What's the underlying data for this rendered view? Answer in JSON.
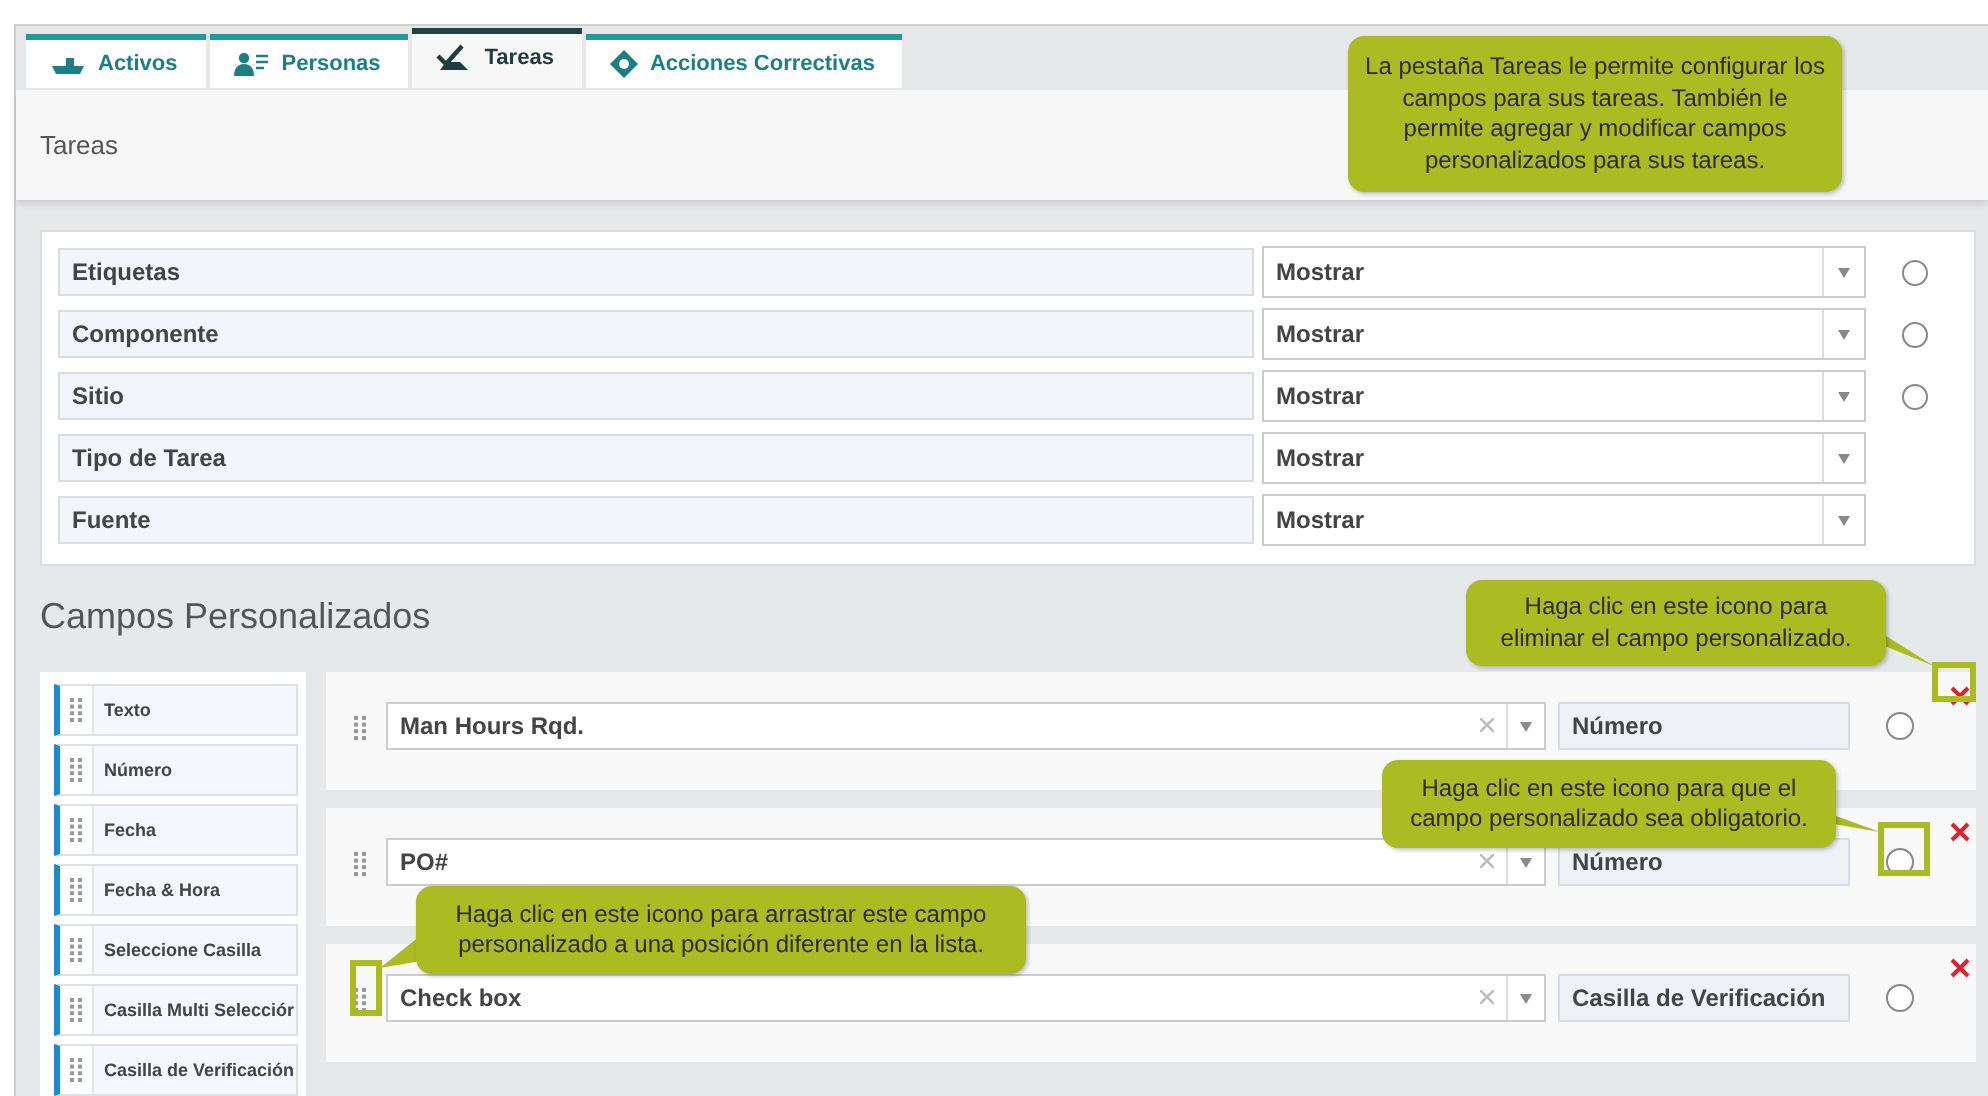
{
  "tabs": [
    {
      "label": "Activos",
      "selected": false
    },
    {
      "label": "Personas",
      "selected": false
    },
    {
      "label": "Tareas",
      "selected": true
    },
    {
      "label": "Acciones Correctivas",
      "selected": false
    }
  ],
  "page_title": "Tareas",
  "standard_fields": [
    {
      "label": "Etiquetas",
      "visibility": "Mostrar",
      "required": false
    },
    {
      "label": "Componente",
      "visibility": "Mostrar",
      "required": false
    },
    {
      "label": "Sitio",
      "visibility": "Mostrar",
      "required": false
    },
    {
      "label": "Tipo de Tarea",
      "visibility": "Mostrar"
    },
    {
      "label": "Fuente",
      "visibility": "Mostrar"
    }
  ],
  "custom_section_title": "Campos Personalizados",
  "field_types": [
    "Texto",
    "Número",
    "Fecha",
    "Fecha & Hora",
    "Seleccione Casilla",
    "Casilla Multi Selecciór",
    "Casilla de Verificación"
  ],
  "custom_fields": [
    {
      "name": "Man Hours Rqd.",
      "type": "Número",
      "required": false
    },
    {
      "name": "PO#",
      "type": "Número",
      "required": false
    },
    {
      "name": "Check box",
      "type": "Casilla de Verificación",
      "required": false
    }
  ],
  "callouts": [
    {
      "kind": "tab",
      "text": "La pestaña Tareas le permite configurar los campos para sus tareas. También le permite agregar y modificar campos personalizados para sus tareas."
    },
    {
      "kind": "delete",
      "text": "Haga clic en este icono para eliminar el campo personalizado."
    },
    {
      "kind": "required",
      "text": "Haga clic en este icono para que el campo personalizado sea obligatorio."
    },
    {
      "kind": "drag",
      "text": "Haga clic en este icono para arrastrar este campo personalizado a una posición diferente en la lista."
    }
  ]
}
